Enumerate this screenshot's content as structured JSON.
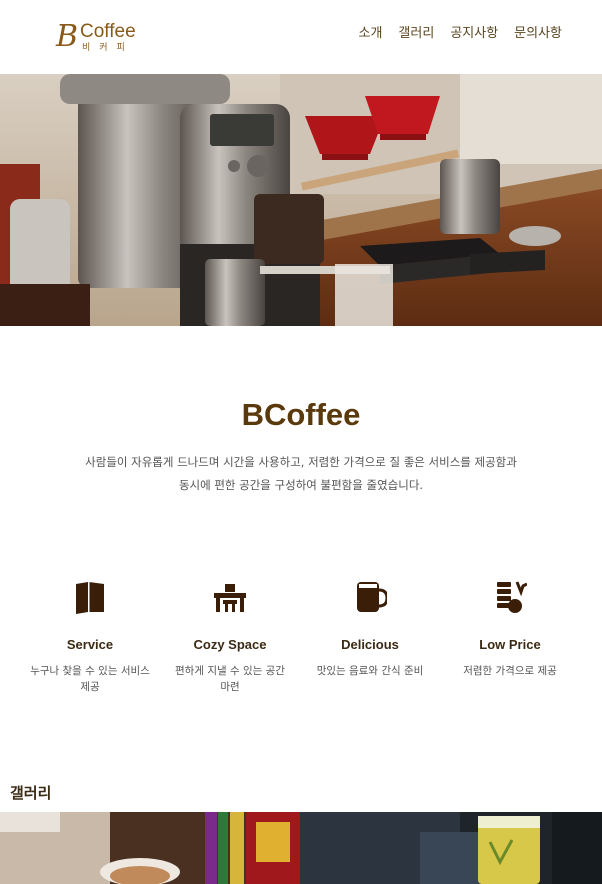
{
  "header": {
    "logo": {
      "letter": "B",
      "word": "Coffee",
      "sub": "비커피"
    },
    "nav": [
      {
        "label": "소개"
      },
      {
        "label": "갤러리"
      },
      {
        "label": "공지사항"
      },
      {
        "label": "문의사항"
      }
    ]
  },
  "intro": {
    "title": "BCoffee",
    "description_line1": "사람들이 자유롭게 드나드며 시간을 사용하고, 저렴한 가격으로 질 좋은 서비스를 제공함과",
    "description_line2": "동시에 편한 공간을 구성하여 불편함을 줄였습니다."
  },
  "features": [
    {
      "icon": "book-icon",
      "title": "Service",
      "desc": "누구나 찾을 수 있는 서비스 제공"
    },
    {
      "icon": "desk-icon",
      "title": "Cozy Space",
      "desc": "편하게 지낼 수 있는 공간 마련"
    },
    {
      "icon": "mug-icon",
      "title": "Delicious",
      "desc": "맛있는 음료와 간식 준비"
    },
    {
      "icon": "coins-icon",
      "title": "Low Price",
      "desc": "저렴한 가격으로 제공"
    }
  ],
  "gallery": {
    "title": "갤러리"
  },
  "colors": {
    "brand": "#8a5a1a",
    "accent": "#5a3a0c",
    "icon": "#3a1e08"
  }
}
